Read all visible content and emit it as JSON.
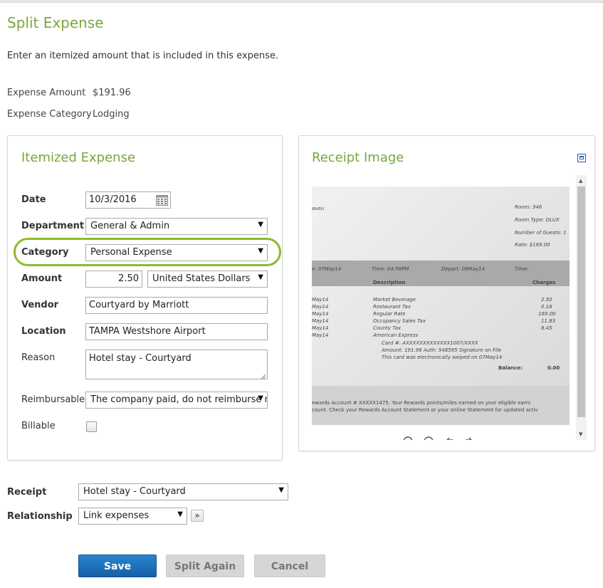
{
  "page": {
    "title": "Split Expense",
    "intro": "Enter an itemized amount that is included in this expense."
  },
  "summary": {
    "amount_label": "Expense Amount",
    "amount_value": "$191.96",
    "category_label": "Expense Category",
    "category_value": "Lodging"
  },
  "itemized": {
    "title": "Itemized Expense",
    "date_label": "Date",
    "date_value": "10/3/2016",
    "department_label": "Department",
    "department_value": "General & Admin",
    "category_label": "Category",
    "category_value": "Personal Expense",
    "amount_label": "Amount",
    "amount_value": "2.50",
    "currency_value": "United States Dollars",
    "vendor_label": "Vendor",
    "vendor_value": "Courtyard by Marriott",
    "location_label": "Location",
    "location_value": "TAMPA Westshore Airport",
    "reason_label": "Reason",
    "reason_value": "Hotel stay - Courtyard",
    "reimbursable_label": "Reimbursable",
    "reimbursable_value": "The company paid, do not reimburse me",
    "billable_label": "Billable"
  },
  "receipt_panel": {
    "title": "Receipt Image",
    "image_text": {
      "room": "Room: 346",
      "room_type": "Room Type: DLUX",
      "guests": "Number of Guests: 1",
      "rate": "Rate: $169.00",
      "left_top": "aveu",
      "arr": "e: 07May14",
      "time": "Time: 04:56PM",
      "depart": "Depart: 08May14",
      "time2": "Time:",
      "description": "Description",
      "charges": "Charges",
      "dates": [
        "May14",
        "May14",
        "May14",
        "May14",
        "May14",
        "May14"
      ],
      "items": [
        "Market Beverage",
        "Restaurant Tax",
        "Regular Rate",
        "Occupancy Sales Tax",
        "County Tax",
        "American Express"
      ],
      "amounts": [
        "2.50",
        "0.18",
        "169.00",
        "11.83",
        "8.45"
      ],
      "card_line": "Card #: AXXXXXXXXXXXXX1007/XXXX",
      "amount_line": "Amount:   191.96  Auth: 548595  Signature on File",
      "swiped_line": "This card was electronically swiped on 07May14",
      "balance_label": "Balance:",
      "balance_value": "0.00",
      "rewards_line1": "ewards Account # XXXXX1475.  Your Rewards points/miles earned on your eligible earni",
      "rewards_line2": "count. Check your Rewards Account Statement or your online Statement for updated activ"
    }
  },
  "bottom": {
    "receipt_label": "Receipt",
    "receipt_value": "Hotel stay - Courtyard",
    "relationship_label": "Relationship",
    "relationship_value": "Link expenses",
    "more_glyph": "»"
  },
  "buttons": {
    "save": "Save",
    "split_again": "Split Again",
    "cancel": "Cancel"
  },
  "colors": {
    "accent_green": "#7aa63a",
    "highlight_green": "#8dbb2c",
    "primary_blue": "#1a6fbd"
  }
}
